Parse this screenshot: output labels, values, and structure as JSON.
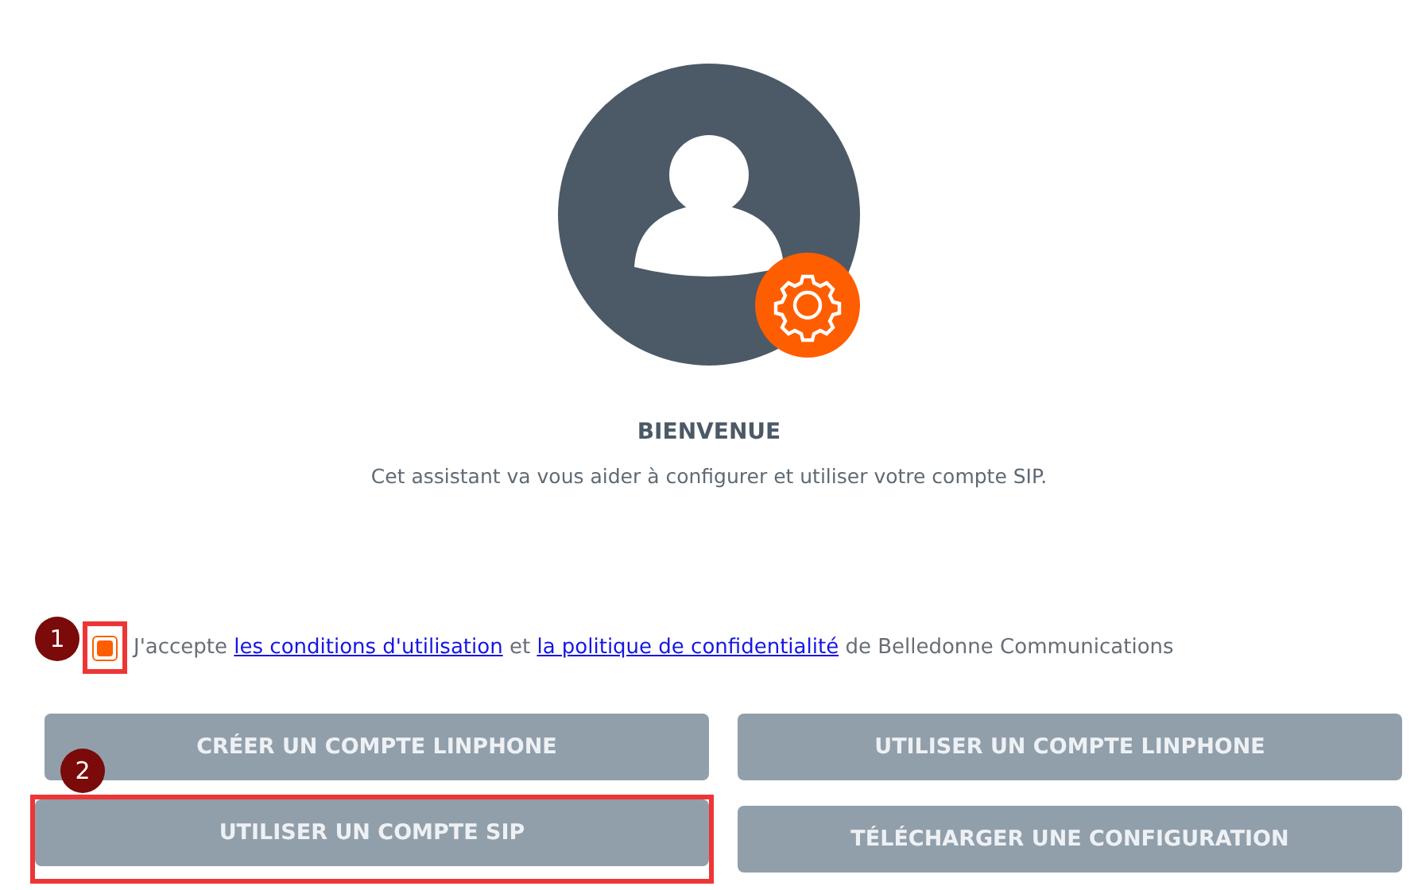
{
  "title": "BIENVENUE",
  "subtitle": "Cet assistant va vous aider à configurer et utiliser votre compte SIP.",
  "terms": {
    "checked": true,
    "callout": "1",
    "highlighted": true,
    "before": "J'accepte",
    "link_1": "les conditions d'utilisation",
    "middle": "et",
    "link_2": "la politique de confidentialité",
    "after": "de Belledonne Communications"
  },
  "buttons": [
    {
      "label": "CRÉER UN COMPTE LINPHONE",
      "highlighted": false
    },
    {
      "label": "UTILISER UN COMPTE LINPHONE",
      "highlighted": false
    },
    {
      "label": "UTILISER UN COMPTE SIP",
      "highlighted": true,
      "callout": "2"
    },
    {
      "label": "TÉLÉCHARGER UNE CONFIGURATION",
      "highlighted": false
    }
  ]
}
